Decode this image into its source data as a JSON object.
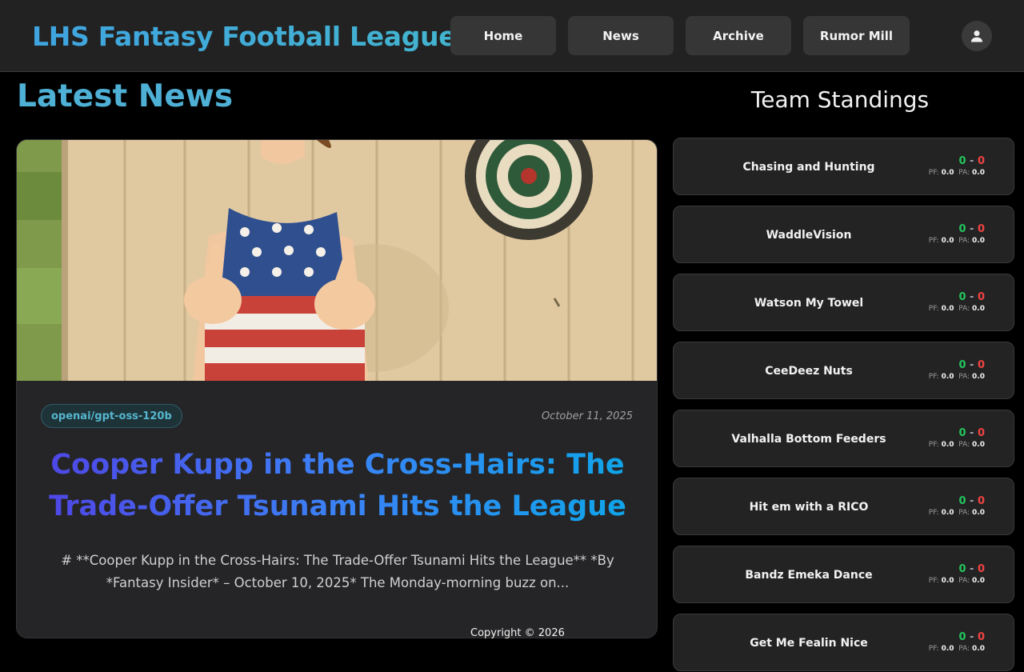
{
  "header": {
    "title": "LHS Fantasy Football League",
    "nav": [
      "Home",
      "News",
      "Archive",
      "Rumor Mill"
    ],
    "profile_icon": "user-icon"
  },
  "main": {
    "heading": "Latest News",
    "article": {
      "image": "boy-in-flag-tank-top-thumbs-up-dartboard",
      "badge": "openai/gpt-oss-120b",
      "date": "October 11, 2025",
      "title": "Cooper Kupp in the Cross-Hairs: The Trade-Offer Tsunami Hits the League",
      "excerpt": "# **Cooper Kupp in the Cross-Hairs: The Trade-Offer Tsunami Hits the League** *By *Fantasy Insider* – October 10, 2025* The Monday-morning buzz on..."
    }
  },
  "standings": {
    "heading": "Team Standings",
    "pf_label": "PF:",
    "pa_label": "PA:",
    "teams": [
      {
        "name": "Chasing and Hunting",
        "wins": "0",
        "losses": "0",
        "pf": "0.0",
        "pa": "0.0"
      },
      {
        "name": "WaddleVision",
        "wins": "0",
        "losses": "0",
        "pf": "0.0",
        "pa": "0.0"
      },
      {
        "name": "Watson My Towel",
        "wins": "0",
        "losses": "0",
        "pf": "0.0",
        "pa": "0.0"
      },
      {
        "name": "CeeDeez Nuts",
        "wins": "0",
        "losses": "0",
        "pf": "0.0",
        "pa": "0.0"
      },
      {
        "name": "Valhalla Bottom Feeders",
        "wins": "0",
        "losses": "0",
        "pf": "0.0",
        "pa": "0.0"
      },
      {
        "name": "Hit em with a RICO",
        "wins": "0",
        "losses": "0",
        "pf": "0.0",
        "pa": "0.0"
      },
      {
        "name": "Bandz Emeka Dance",
        "wins": "0",
        "losses": "0",
        "pf": "0.0",
        "pa": "0.0"
      },
      {
        "name": "Get Me Fealin Nice",
        "wins": "0",
        "losses": "0",
        "pf": "0.0",
        "pa": "0.0"
      }
    ]
  },
  "footer": {
    "copyright": "Copyright © 2026"
  }
}
